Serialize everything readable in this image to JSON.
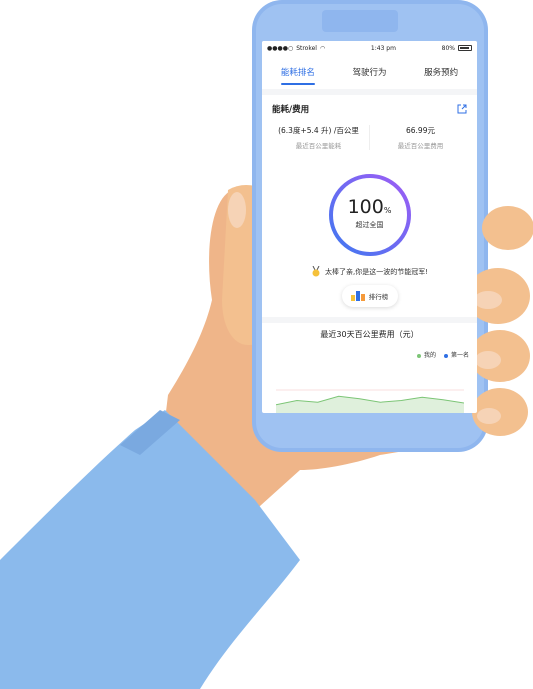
{
  "status_bar": {
    "carrier": "Strokel",
    "time": "1:43 pm",
    "battery": "80%"
  },
  "tabs": [
    {
      "label": "能耗排名",
      "active": true
    },
    {
      "label": "驾驶行为",
      "active": false
    },
    {
      "label": "服务预约",
      "active": false
    }
  ],
  "energy": {
    "title": "能耗/费用",
    "consumption_value": "(6.3度+5.4 升) /百公里",
    "consumption_label": "最近百公里能耗",
    "cost_value": "66.99元",
    "cost_label": "最近百公里费用",
    "percent": "100",
    "percent_unit": "%",
    "percent_label": "超过全国",
    "progress": 1.0,
    "praise": "太棒了亲,你是这一波的节能冠军!",
    "rank_button": "排行榜"
  },
  "chart_data": {
    "type": "area",
    "title": "最近30天百公里费用（元）",
    "series": [
      {
        "name": "我的",
        "color": "#7cc576",
        "values": [
          2,
          3,
          2.6,
          4,
          3.4,
          2.6,
          3,
          3.8,
          3.2,
          2.4
        ]
      },
      {
        "name": "第一名",
        "color": "#2f6fe4",
        "values": []
      }
    ]
  },
  "colors": {
    "accent": "#2f6fe4",
    "ring_start": "#3f78f0",
    "ring_end": "#a05cf5",
    "phone_blue": "#8fb6ee",
    "skin": "#f0b98a",
    "sleeve": "#8bb9ec"
  }
}
